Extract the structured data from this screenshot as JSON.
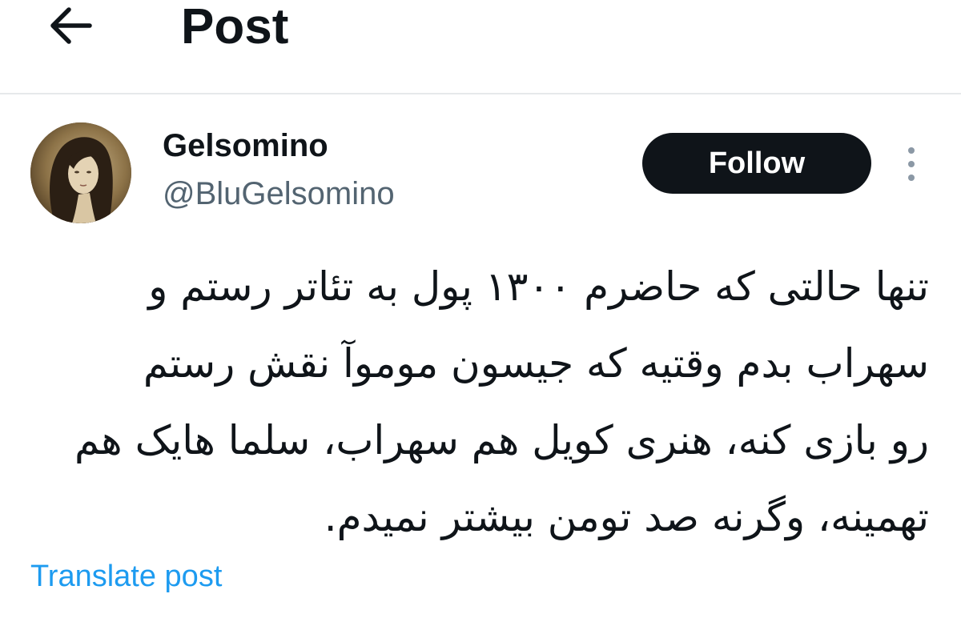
{
  "header": {
    "back_icon": "arrow-left-icon",
    "title": "Post"
  },
  "author": {
    "display_name": "Gelsomino",
    "handle": "@BluGelsomino",
    "avatar": "portrait-avatar"
  },
  "actions": {
    "follow_label": "Follow",
    "more_icon": "vertical-dots-icon"
  },
  "post": {
    "lines": [
      "تنها حالتی که حاضرم ۱۳۰۰ پول به تئاتر رستم و",
      "سهراب بدم وقتیه که جیسون موموآ نقش رستم",
      "رو بازی کنه، هنری کویل هم سهراب، سلما هایک هم",
      "تهمینه، وگرنه صد تومن بیشتر نمیدم."
    ]
  },
  "translate_label": "Translate post",
  "colors": {
    "text": "#0f1419",
    "secondary": "#536471",
    "link": "#1d9bf0",
    "divider": "#e6e9eb"
  }
}
